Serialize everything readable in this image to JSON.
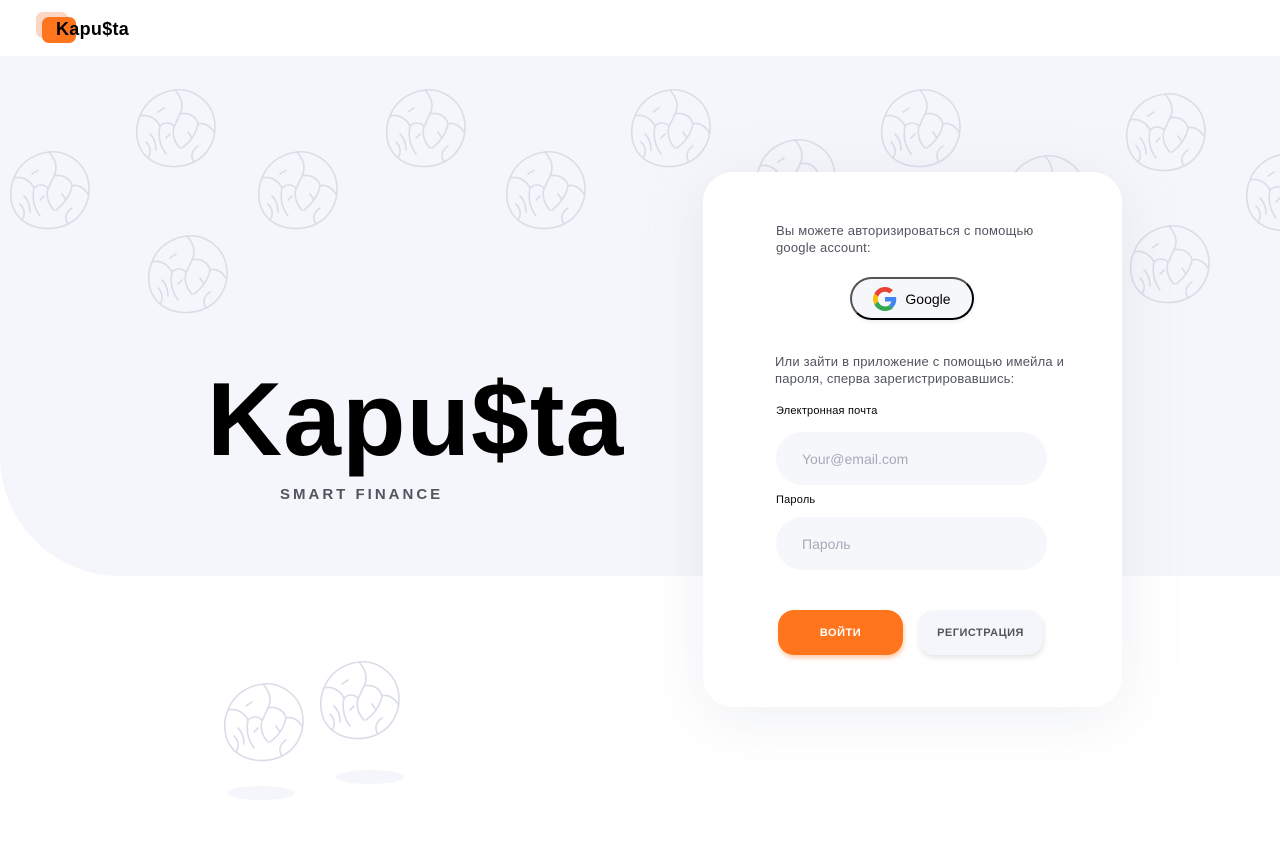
{
  "header": {
    "logo_text": "Kapu$ta"
  },
  "hero": {
    "title": "Kapu$ta",
    "subtitle": "SMART FINANCE"
  },
  "auth": {
    "google_prompt": "Вы можете авторизироваться с помощью google account:",
    "google_button_label": "Google",
    "email_prompt": "Или зайти в приложение с помощью имейла и пароля, сперва зарегистрировавшись:",
    "email_label": "Электронная почта",
    "email_placeholder": "Your@email.com",
    "email_value": "",
    "password_label": "Пароль",
    "password_placeholder": "Пароль",
    "password_value": "",
    "login_button": "ВОЙТИ",
    "register_button": "РЕГИСТРАЦИЯ"
  },
  "icons": {
    "decor": "cabbage-icon",
    "google": "google-icon"
  },
  "colors": {
    "accent": "#ff751d",
    "hero_bg": "#f5f6fb",
    "text": "#52555f",
    "cabbage_stroke": "#d9dde8"
  }
}
